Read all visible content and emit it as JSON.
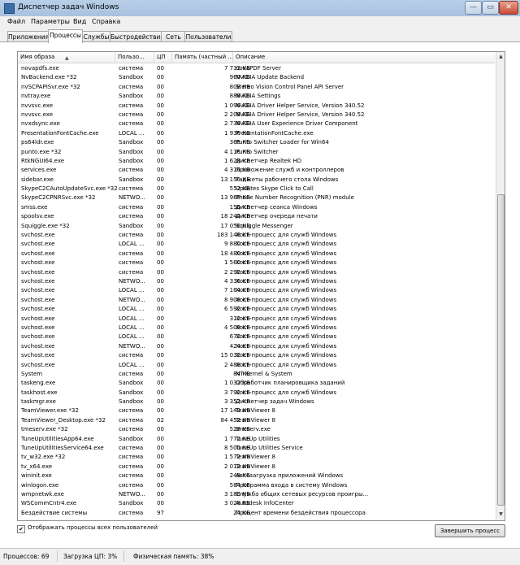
{
  "window": {
    "title": "Диспетчер задач Windows",
    "controls": [
      "—",
      "▭",
      "✕"
    ]
  },
  "menu": [
    "Файл",
    "Параметры",
    "Вид",
    "Справка"
  ],
  "tabs": [
    "Приложения",
    "Процессы",
    "Службы",
    "Быстродействие",
    "Сеть",
    "Пользователи"
  ],
  "active_tab": "Процессы",
  "columns": [
    "Имя образа",
    "Пользо...",
    "ЦП",
    "Память (частный ...",
    "Описание"
  ],
  "processes": [
    [
      "novapdfs.exe",
      "система",
      "00",
      "7 732 КБ",
      "novaPDF Server"
    ],
    [
      "NvBackend.exe *32",
      "Sandbox",
      "00",
      "960 КБ",
      "NVIDIA Update Backend"
    ],
    [
      "nvSCPAPISvr.exe *32",
      "система",
      "00",
      "808 КБ",
      "Stereo Vision Control Panel API Server"
    ],
    [
      "nvtray.exe",
      "Sandbox",
      "00",
      "888 КБ",
      "NVIDIA Settings"
    ],
    [
      "nvvsvc.exe",
      "система",
      "00",
      "1 096 КБ",
      "NVIDIA Driver Helper Service, Version 340.52"
    ],
    [
      "nvvsvc.exe",
      "система",
      "00",
      "2 208 КБ",
      "NVIDIA Driver Helper Service, Version 340.52"
    ],
    [
      "nvxdsync.exe",
      "система",
      "00",
      "2 736 КБ",
      "NVIDIA User Experience Driver Component"
    ],
    [
      "PresentationFontCache.exe",
      "LOCAL ...",
      "00",
      "1 936 КБ",
      "PresentationFontCache.exe"
    ],
    [
      "ps64ldr.exe",
      "Sandbox",
      "00",
      "368 КБ",
      "Punto Switcher Loader for Win64"
    ],
    [
      "punto.exe *32",
      "Sandbox",
      "00",
      "4 116 КБ",
      "Punto Switcher"
    ],
    [
      "RtkNGUI64.exe",
      "Sandbox",
      "00",
      "1 628 КБ",
      "Диспетчер Realtek HD"
    ],
    [
      "services.exe",
      "система",
      "00",
      "4 316 КБ",
      "Приложение служб и контроллеров"
    ],
    [
      "sidebar.exe",
      "Sandbox",
      "00",
      "13 156 КБ",
      "Гаджеты рабочего стола Windows"
    ],
    [
      "SkypeC2CAutoUpdateSvc.exe *32",
      "система",
      "00",
      "552 КБ",
      "Updates Skype Click to Call"
    ],
    [
      "SkypeC2CPNRSvc.exe *32",
      "NETWO...",
      "00",
      "13 968 КБ",
      "Phone Number Recognition (PNR) module"
    ],
    [
      "smss.exe",
      "система",
      "00",
      "156 КБ",
      "Диспетчер сеанса  Windows"
    ],
    [
      "spoolsv.exe",
      "система",
      "00",
      "18 244 КБ",
      "Диспетчер очереди печати"
    ],
    [
      "Squiggle.exe *32",
      "Sandbox",
      "00",
      "17 056 КБ",
      "Squiggle Messenger"
    ],
    [
      "svchost.exe",
      "система",
      "00",
      "183 148 КБ",
      "Хост-процесс для служб Windows"
    ],
    [
      "svchost.exe",
      "LOCAL ...",
      "00",
      "9 880 КБ",
      "Хост-процесс для служб Windows"
    ],
    [
      "svchost.exe",
      "система",
      "00",
      "18 480 КБ",
      "Хост-процесс для служб Windows"
    ],
    [
      "svchost.exe",
      "система",
      "00",
      "1 560 КБ",
      "Хост-процесс для служб Windows"
    ],
    [
      "svchost.exe",
      "система",
      "00",
      "2 292 КБ",
      "Хост-процесс для служб Windows"
    ],
    [
      "svchost.exe",
      "NETWO...",
      "00",
      "4 336 КБ",
      "Хост-процесс для служб Windows"
    ],
    [
      "svchost.exe",
      "LOCAL ...",
      "00",
      "7 164 КБ",
      "Хост-процесс для служб Windows"
    ],
    [
      "svchost.exe",
      "NETWO...",
      "00",
      "8 908 КБ",
      "Хост-процесс для служб Windows"
    ],
    [
      "svchost.exe",
      "LOCAL ...",
      "00",
      "6 592 КБ",
      "Хост-процесс для служб Windows"
    ],
    [
      "svchost.exe",
      "LOCAL ...",
      "00",
      "312 КБ",
      "Хост-процесс для служб Windows"
    ],
    [
      "svchost.exe",
      "LOCAL ...",
      "00",
      "4 508 КБ",
      "Хост-процесс для служб Windows"
    ],
    [
      "svchost.exe",
      "LOCAL ...",
      "00",
      "672 КБ",
      "Хост-процесс для служб Windows"
    ],
    [
      "svchost.exe",
      "NETWO...",
      "00",
      "424 КБ",
      "Хост-процесс для служб Windows"
    ],
    [
      "svchost.exe",
      "система",
      "00",
      "15 032 КБ",
      "Хост-процесс для служб Windows"
    ],
    [
      "svchost.exe",
      "LOCAL ...",
      "00",
      "2 488 КБ",
      "Хост-процесс для служб Windows"
    ],
    [
      "System",
      "система",
      "00",
      "84 КБ",
      "NT Kernel & System"
    ],
    [
      "taskeng.exe",
      "Sandbox",
      "00",
      "1 032 КБ",
      "Обработчик планировщика заданий"
    ],
    [
      "taskhost.exe",
      "Sandbox",
      "00",
      "3 792 КБ",
      "Хост-процесс для служб Windows"
    ],
    [
      "taskmgr.exe",
      "Sandbox",
      "00",
      "3 352 КБ",
      "Диспетчер задач Windows"
    ],
    [
      "TeamViewer.exe *32",
      "система",
      "00",
      "17 140 КБ",
      "TeamViewer 8"
    ],
    [
      "TeamViewer_Desktop.exe *32",
      "система",
      "02",
      "84 452 КБ",
      "TeamViewer 8"
    ],
    [
      "tmeserv.exe *32",
      "система",
      "00",
      "528 КБ",
      "tmeserv.exe"
    ],
    [
      "TuneUpUtilitiesApp64.exe",
      "Sandbox",
      "00",
      "1 772 КБ",
      "TuneUp Utilities"
    ],
    [
      "TuneUpUtilitiesService64.exe",
      "система",
      "00",
      "8 500 КБ",
      "TuneUp Utilities Service"
    ],
    [
      "tv_w32.exe *32",
      "система",
      "00",
      "1 572 КБ",
      "TeamViewer 8"
    ],
    [
      "tv_x64.exe",
      "система",
      "00",
      "2 012 КБ",
      "TeamViewer 8"
    ],
    [
      "wininit.exe",
      "система",
      "00",
      "248 КБ",
      "Автозагрузка приложений Windows"
    ],
    [
      "winlogon.exe",
      "система",
      "00",
      "584 КБ",
      "Программа входа в систему Windows"
    ],
    [
      "wmpnetwk.exe",
      "NETWO...",
      "00",
      "3 188 КБ",
      "Служба общих сетевых ресурсов проигры..."
    ],
    [
      "WSCommCntr4.exe",
      "Sandbox",
      "00",
      "3 028 КБ",
      "Autodesk InfoCenter"
    ],
    [
      "Бездействие системы",
      "система",
      "97",
      "24 КБ",
      "Процент времени бездействия процессора"
    ]
  ],
  "show_all_users": {
    "checked": true,
    "label": "Отображать процессы всех пользователей"
  },
  "end_process_label": "Завершить процесс",
  "status": {
    "processes": "Процессов: 69",
    "cpu": "Загрузка ЦП: 3%",
    "memory": "Физическая память: 38%"
  },
  "colors": {
    "frame": "#c9d8ea",
    "titlebar": "#b9cfe8",
    "close_button": "#c74a34"
  }
}
